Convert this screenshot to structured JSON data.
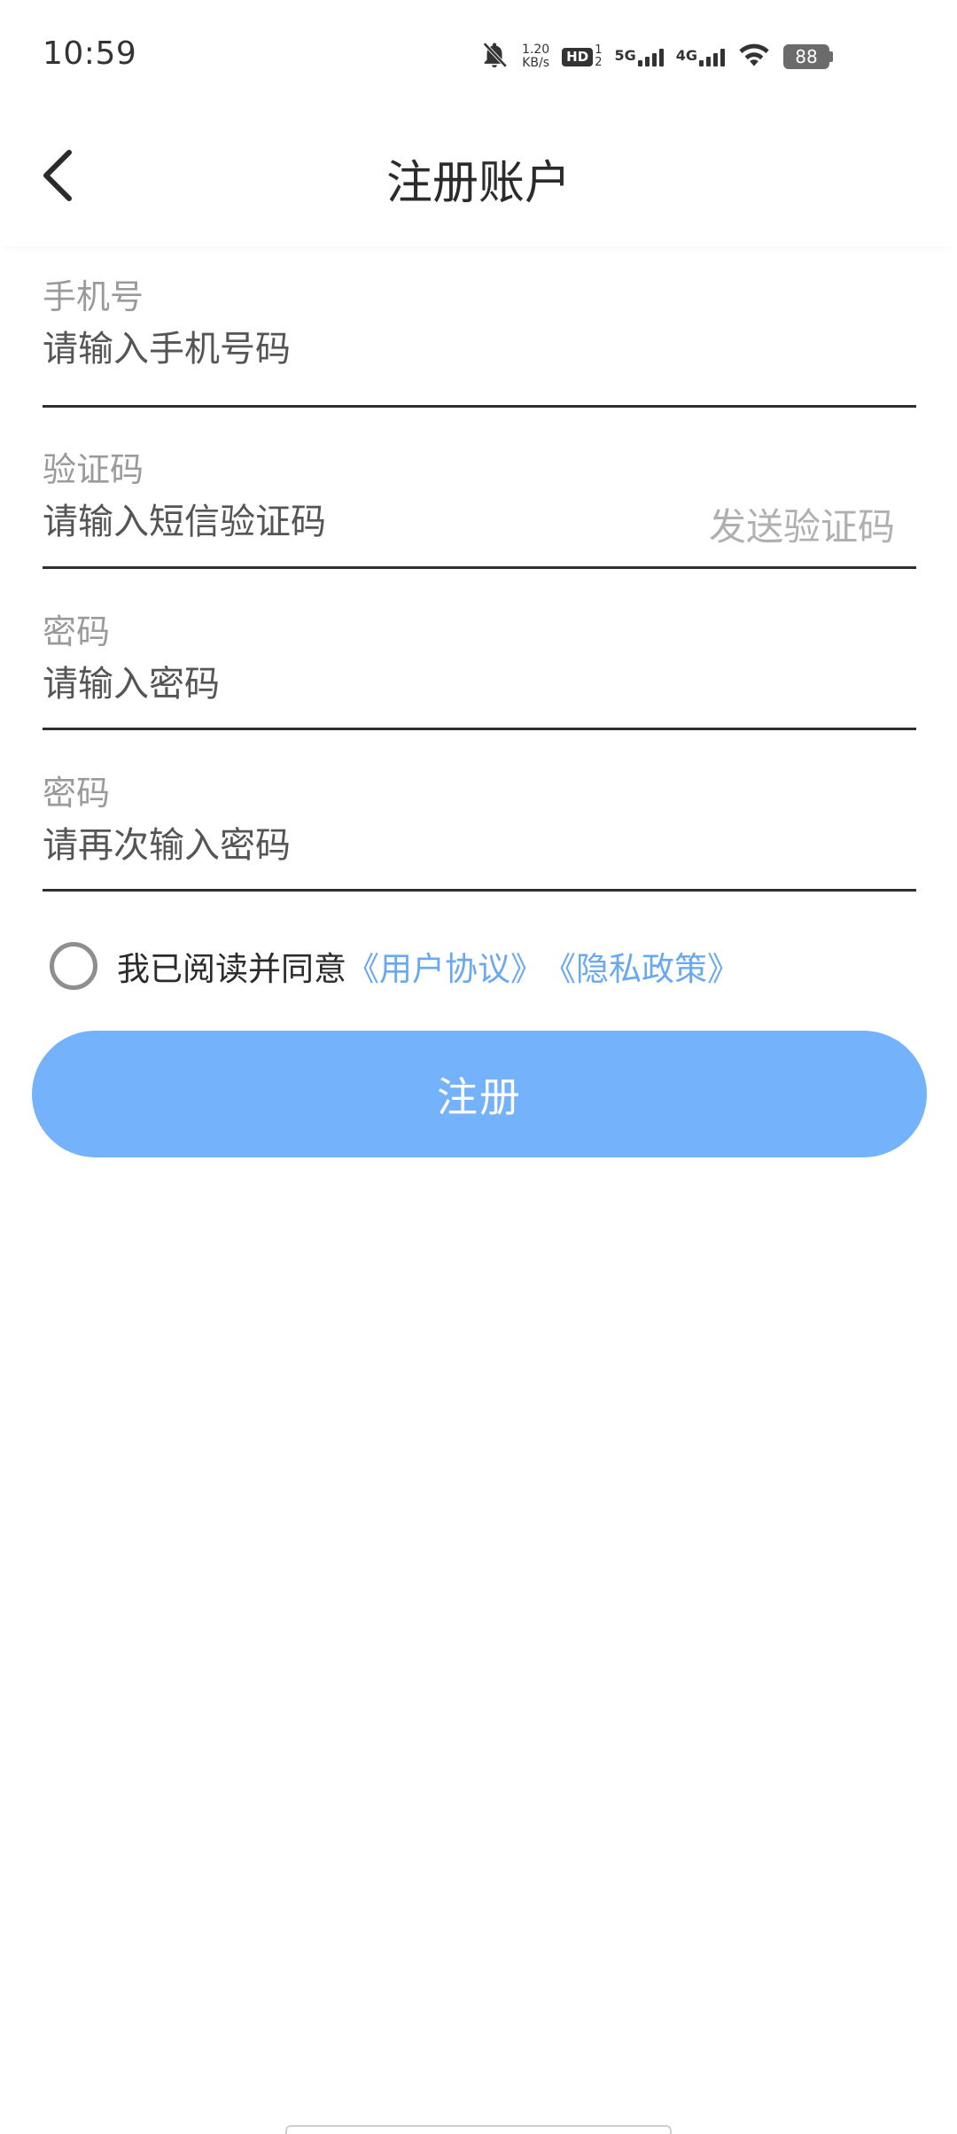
{
  "status_bar": {
    "time": "10:59",
    "net_speed_value": "1.20",
    "net_speed_unit": "KB/s",
    "hd_label": "HD",
    "hd_sim_1": "1",
    "hd_sim_2": "2",
    "network_5g": "5G",
    "network_4g": "4G",
    "battery": "88",
    "icons": [
      "bell-off-icon",
      "signal-icon",
      "wifi-icon",
      "battery-icon"
    ]
  },
  "header": {
    "title": "注册账户",
    "back_icon": "chevron-left-icon"
  },
  "form": {
    "phone": {
      "label": "手机号",
      "placeholder": "请输入手机号码"
    },
    "code": {
      "label": "验证码",
      "placeholder": "请输入短信验证码",
      "send_label": "发送验证码"
    },
    "password": {
      "label": "密码",
      "placeholder": "请输入密码"
    },
    "password_confirm": {
      "label": "密码",
      "placeholder": "请再次输入密码"
    }
  },
  "agreement": {
    "text": "我已阅读并同意",
    "user_agreement": "《用户协议》",
    "privacy_policy": "《隐私政策》",
    "checked": false
  },
  "register_button": {
    "label": "注册",
    "color": "#74b2fb"
  },
  "colors": {
    "link": "#6aa9f0",
    "label": "#9a9a9a"
  }
}
